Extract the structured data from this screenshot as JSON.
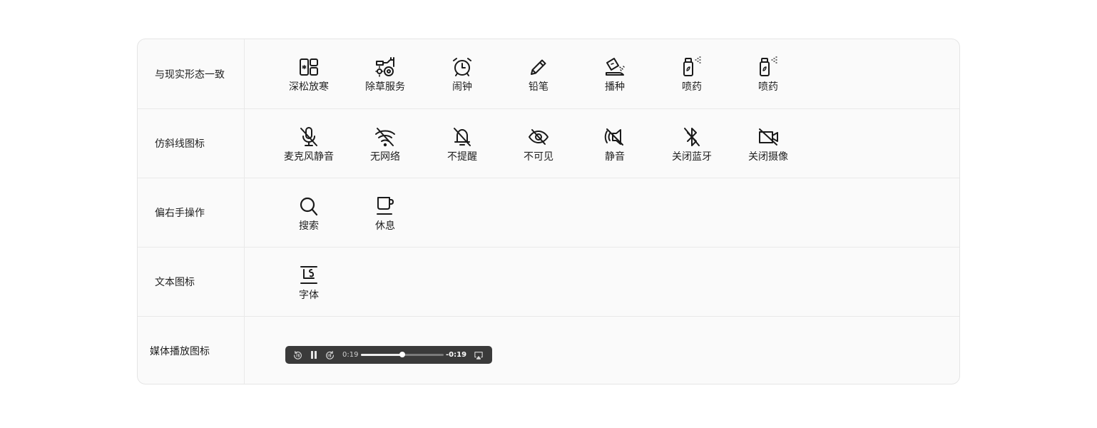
{
  "rows": [
    {
      "label": "与现实形态一致",
      "items": [
        {
          "icon": "freeze-protection-icon",
          "label": "深松放寒"
        },
        {
          "icon": "weeding-service-icon",
          "label": "除草服务"
        },
        {
          "icon": "alarm-clock-icon",
          "label": "闹钟"
        },
        {
          "icon": "pencil-icon",
          "label": "铅笔"
        },
        {
          "icon": "sowing-icon",
          "label": "播种"
        },
        {
          "icon": "spray-bottle-icon",
          "label": "喷药"
        },
        {
          "icon": "spray-bottle-icon",
          "label": "喷药"
        }
      ]
    },
    {
      "label": "仿斜线图标",
      "items": [
        {
          "icon": "mic-mute-icon",
          "label": "麦克风静音"
        },
        {
          "icon": "wifi-off-icon",
          "label": "无网络"
        },
        {
          "icon": "bell-off-icon",
          "label": "不提醒"
        },
        {
          "icon": "eye-off-icon",
          "label": "不可见"
        },
        {
          "icon": "speaker-mute-icon",
          "label": "静音"
        },
        {
          "icon": "bluetooth-off-icon",
          "label": "关闭蓝牙"
        },
        {
          "icon": "camera-off-icon",
          "label": "关闭摄像"
        }
      ]
    },
    {
      "label": "偏右手操作",
      "items": [
        {
          "icon": "search-icon",
          "label": "搜索"
        },
        {
          "icon": "coffee-cup-icon",
          "label": "休息"
        }
      ]
    },
    {
      "label": "文本图标",
      "items": [
        {
          "icon": "font-icon",
          "label": "字体"
        }
      ]
    },
    {
      "label": "媒体播放图标",
      "player": {
        "current_time": "0:19",
        "remaining_time": "-0:19",
        "progress": 0.5,
        "rewind_icon": "rewind-15-icon",
        "pause_icon": "pause-icon",
        "forward_icon": "forward-15-icon",
        "airplay_icon": "airplay-icon"
      }
    }
  ],
  "colors": {
    "table_bg": "#fafafa",
    "border": "#e5e5e5",
    "player_bg": "#3a3a3a",
    "icon_stroke": "#1a1a1a"
  }
}
